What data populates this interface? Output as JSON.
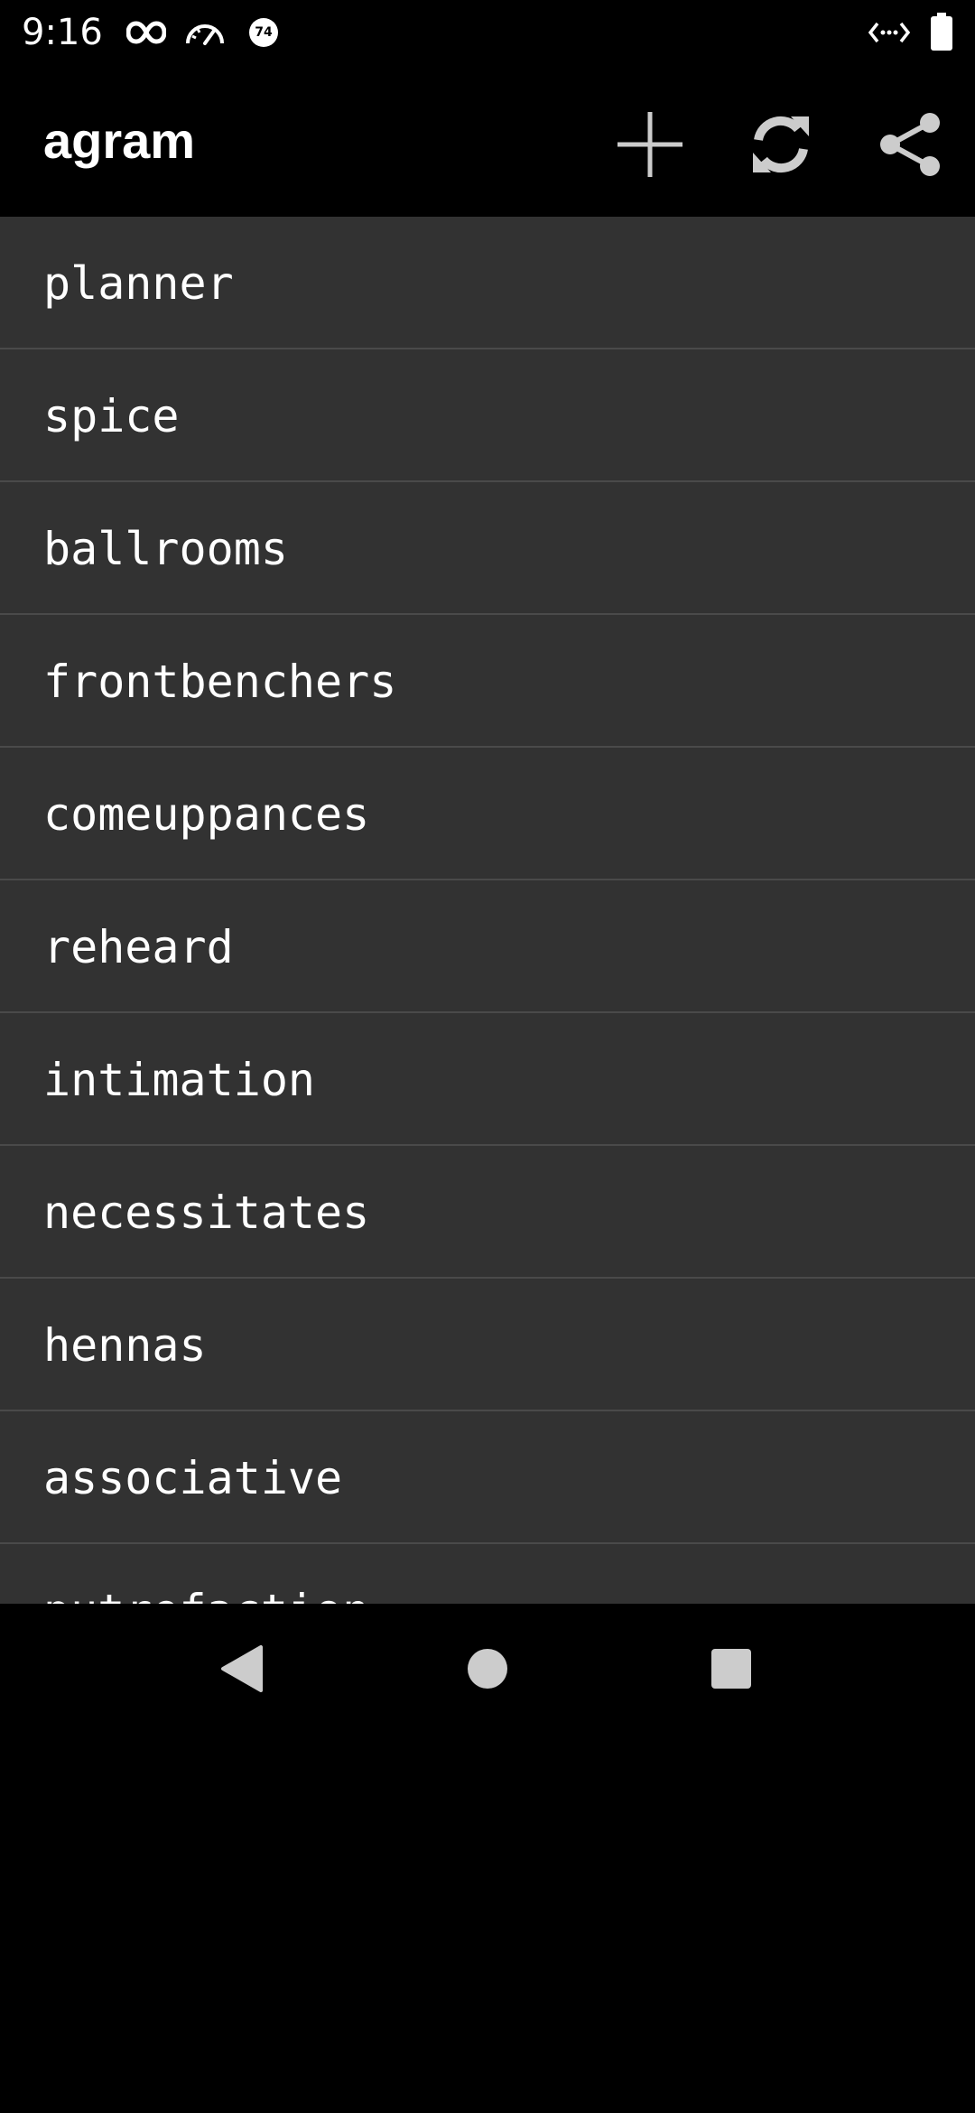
{
  "status_bar": {
    "time": "9:16",
    "left_icons": [
      "infinity-icon",
      "speedometer-icon",
      "badge-74-icon"
    ],
    "badge_text": "74",
    "right_icons": [
      "code-arrows-icon",
      "battery-icon"
    ]
  },
  "app_bar": {
    "title": "agram",
    "actions": [
      "add-icon",
      "refresh-icon",
      "share-icon"
    ]
  },
  "list": {
    "items": [
      "planner",
      "spice",
      "ballrooms",
      "frontbenchers",
      "comeuppances",
      "reheard",
      "intimation",
      "necessitates",
      "hennas",
      "associative",
      "putrefaction"
    ]
  },
  "nav_bar": {
    "buttons": [
      "back-icon",
      "home-icon",
      "recents-icon"
    ]
  },
  "colors": {
    "background": "#000000",
    "list_background": "#323232",
    "divider": "#4a4a4a",
    "icon": "#cccccc",
    "text": "#ffffff"
  }
}
